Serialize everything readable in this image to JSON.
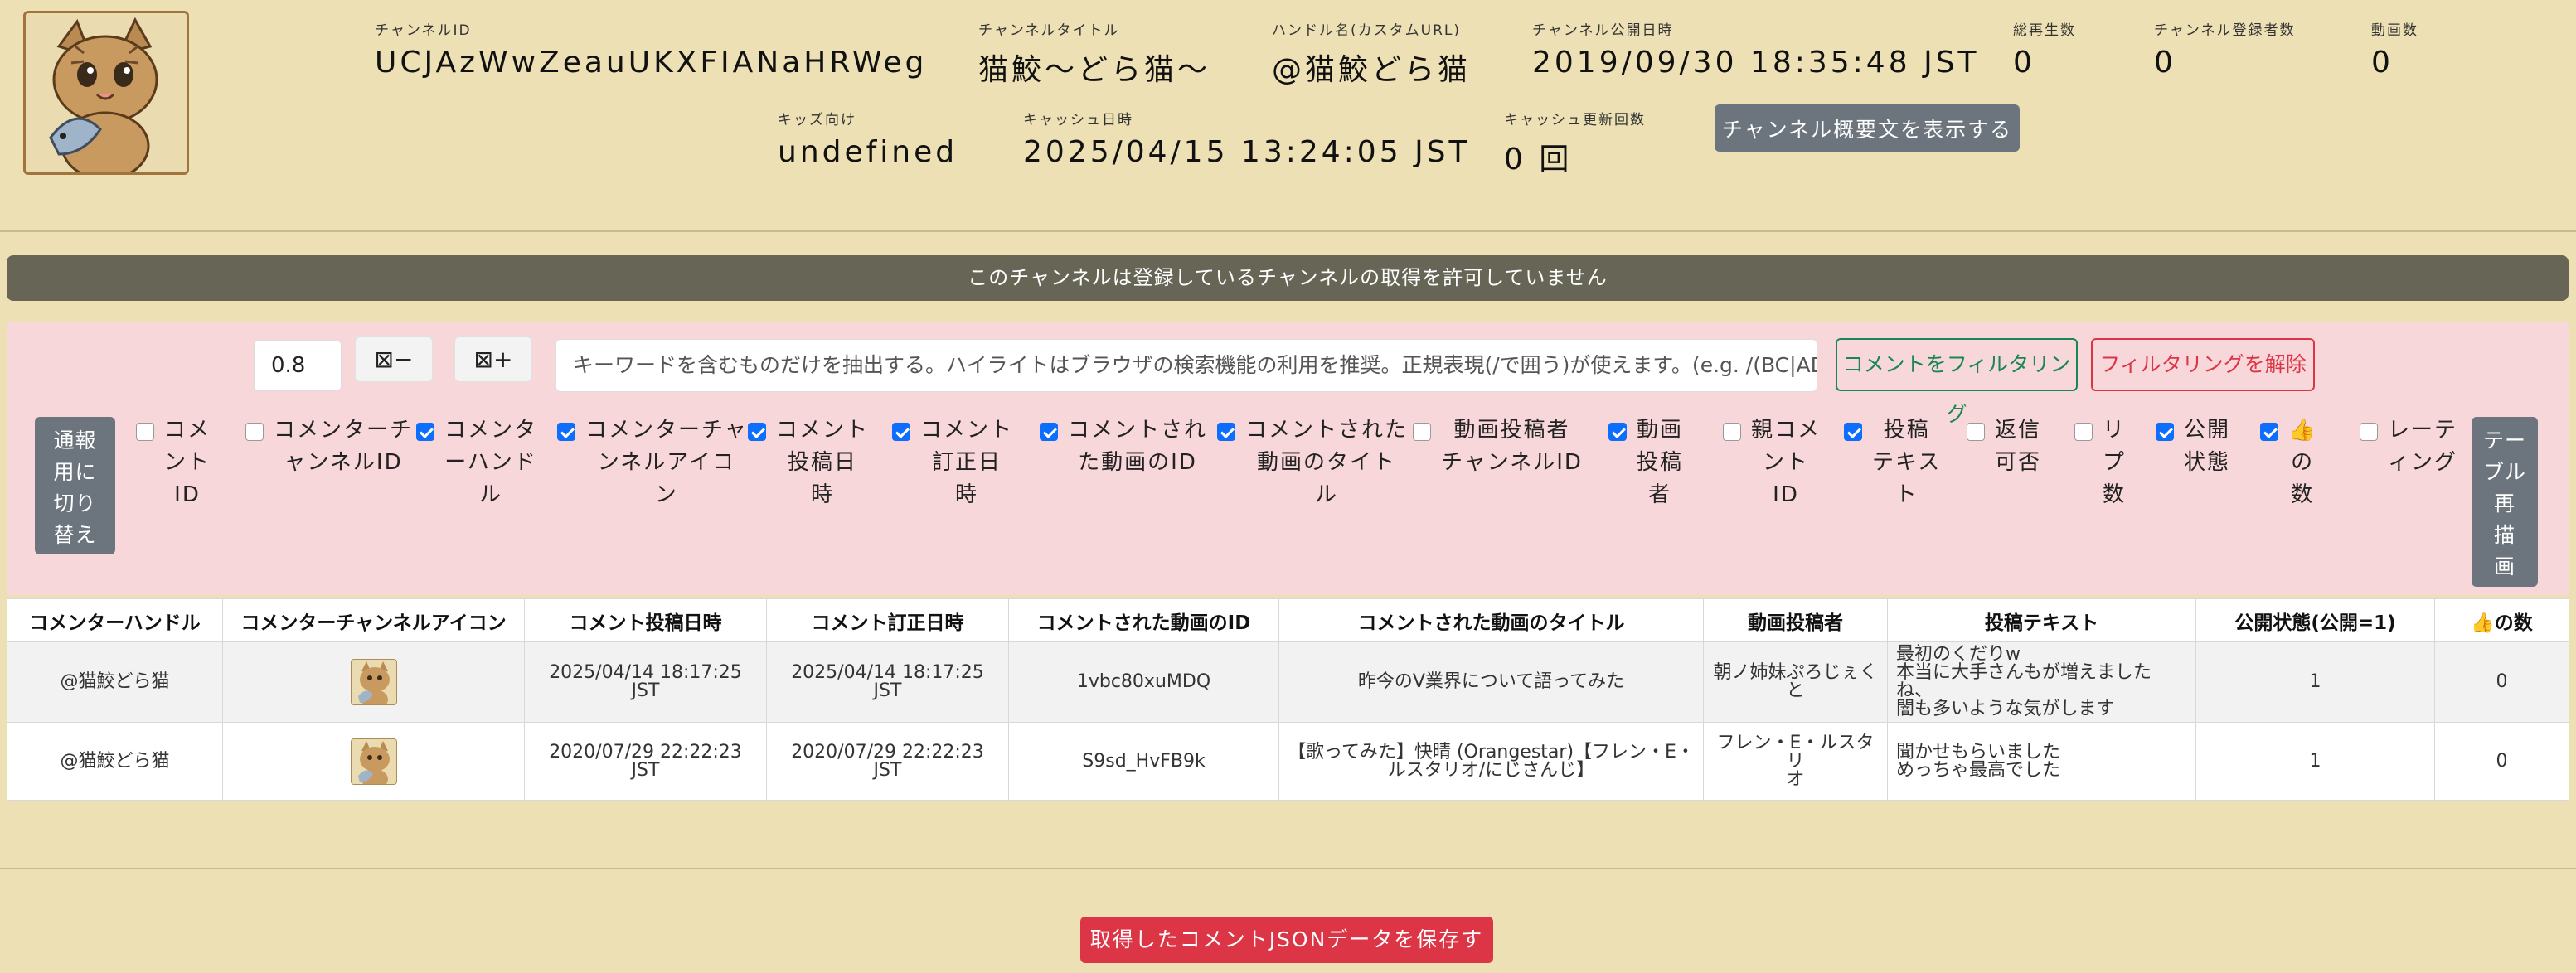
{
  "header": {
    "channel_id": {
      "label": "チャンネルID",
      "value": "UCJAzWwZeauUKXFIANaHRWeg"
    },
    "channel_title": {
      "label": "チャンネルタイトル",
      "value": "猫鮫〜どら猫〜"
    },
    "handle": {
      "label": "ハンドル名(カスタムURL)",
      "value": "@猫鮫どら猫"
    },
    "published": {
      "label": "チャンネル公開日時",
      "value": "2019/09/30 18:35:48 JST"
    },
    "total_views": {
      "label": "総再生数",
      "value": "0"
    },
    "subscribers": {
      "label": "チャンネル登録者数",
      "value": "0"
    },
    "videos": {
      "label": "動画数",
      "value": "0"
    },
    "kids": {
      "label": "キッズ向け",
      "value": "undefined"
    },
    "cache_date": {
      "label": "キャッシュ日時",
      "value": "2025/04/15 13:24:05 JST"
    },
    "cache_updates": {
      "label": "キャッシュ更新回数",
      "value": "0 回"
    },
    "show_description_button": "チャンネル概要文を表示する"
  },
  "notice": "このチャンネルは登録しているチャンネルの取得を許可していません",
  "filter": {
    "zoom_value": "0.8",
    "zoom_out_label": "⊠−",
    "zoom_in_label": "⊠+",
    "keyword_placeholder": "キーワードを含むものだけを抽出する。ハイライトはブラウザの検索機能の利用を推奨。正規表現(/で囲う)が使えます。(e.g. /(BC|AD|",
    "filter_button": "コメントをフィルタリング",
    "clear_button": "フィルタリングを解除",
    "mode_toggle_lines": [
      "通報",
      "用に",
      "切り",
      "替え"
    ],
    "redraw_lines": [
      "テー",
      "ブル",
      "再",
      "描",
      "画"
    ]
  },
  "columns_toggle": [
    {
      "lines": [
        "コメ",
        "ント",
        "ID"
      ],
      "checked": false
    },
    {
      "lines": [
        "コメンターチ",
        "ャンネルID"
      ],
      "checked": false
    },
    {
      "lines": [
        "コメンタ",
        "ーハンド",
        "ル"
      ],
      "checked": true
    },
    {
      "lines": [
        "コメンターチャ",
        "ンネルアイコ",
        "ン"
      ],
      "checked": true
    },
    {
      "lines": [
        "コメント",
        "投稿日",
        "時"
      ],
      "checked": true
    },
    {
      "lines": [
        "コメント",
        "訂正日",
        "時"
      ],
      "checked": true
    },
    {
      "lines": [
        "コメントされ",
        "た動画のID"
      ],
      "checked": true
    },
    {
      "lines": [
        "コメントされた",
        "動画のタイト",
        "ル"
      ],
      "checked": true
    },
    {
      "lines": [
        "動画投稿者",
        "チャンネルID"
      ],
      "checked": false
    },
    {
      "lines": [
        "動画",
        "投稿",
        "者"
      ],
      "checked": true
    },
    {
      "lines": [
        "親コメ",
        "ント",
        "ID"
      ],
      "checked": false
    },
    {
      "lines": [
        "投稿",
        "テキス",
        "ト"
      ],
      "checked": true
    },
    {
      "lines": [
        "返信",
        "可否"
      ],
      "checked": false
    },
    {
      "lines": [
        "リ",
        "プ",
        "数"
      ],
      "checked": false
    },
    {
      "lines": [
        "公開",
        "状態"
      ],
      "checked": true
    },
    {
      "lines": [
        "👍",
        "の",
        "数"
      ],
      "checked": true
    },
    {
      "lines": [
        "レーテ",
        "ィング"
      ],
      "checked": false
    }
  ],
  "table": {
    "headers": [
      "コメンターハンドル",
      "コメンターチャンネルアイコン",
      "コメント投稿日時",
      "コメント訂正日時",
      "コメントされた動画のID",
      "コメントされた動画のタイトル",
      "動画投稿者",
      "投稿テキスト",
      "公開状態(公開=1)",
      "👍の数"
    ],
    "rows": [
      {
        "handle": "@猫鮫どら猫",
        "posted": [
          "2025/04/14 18:17:25",
          "JST"
        ],
        "edited": [
          "2025/04/14 18:17:25",
          "JST"
        ],
        "video_id": "1vbc80xuMDQ",
        "video_title": [
          "昨今のV業界について語ってみた"
        ],
        "uploader": [
          "朝ノ姉妹ぷろじぇく",
          "と"
        ],
        "text": [
          "最初のくだりw",
          "本当に大手さんもが増えましたね、",
          "闇も多いような気がします"
        ],
        "public": "1",
        "likes": "0"
      },
      {
        "handle": "@猫鮫どら猫",
        "posted": [
          "2020/07/29 22:22:23",
          "JST"
        ],
        "edited": [
          "2020/07/29 22:22:23",
          "JST"
        ],
        "video_id": "S9sd_HvFB9k",
        "video_title": [
          "【歌ってみた】快晴 (Orangestar)【フレン・E・",
          "ルスタリオ/にじさんじ】"
        ],
        "uploader": [
          "フレン・E・ルスタリ",
          "オ"
        ],
        "text": [
          "聞かせもらいました",
          "めっちゃ最高でした"
        ],
        "public": "1",
        "likes": "0"
      }
    ]
  },
  "save_button": "取得したコメントJSONデータを保存する",
  "colors": {
    "background": "#ede0b4",
    "panel": "#f8d7da",
    "notice": "#666556",
    "primary": "#0d6efd",
    "danger": "#dc3545",
    "success": "#198754",
    "secondary": "#6c757d"
  }
}
